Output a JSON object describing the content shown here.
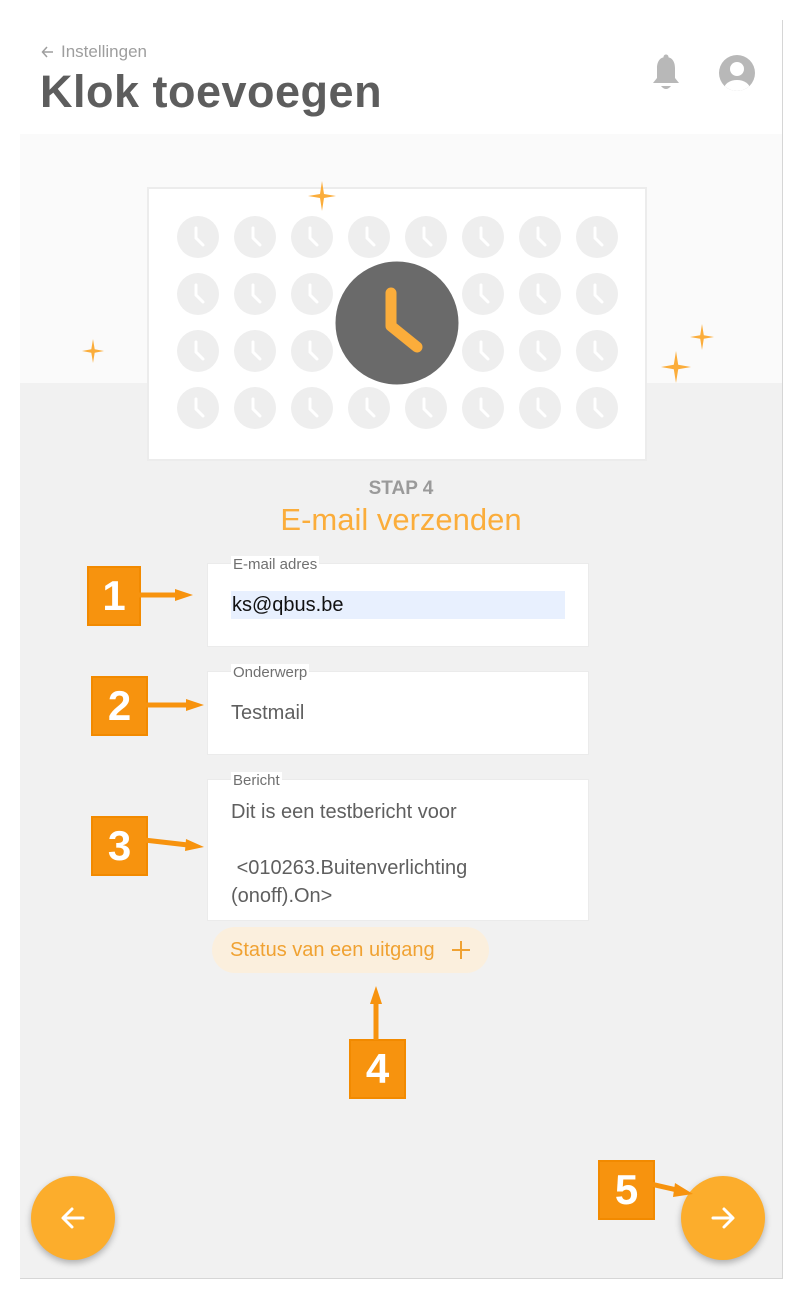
{
  "header": {
    "back_label": "Instellingen",
    "title": "Klok toevoegen",
    "icons": [
      "arrow-left-icon",
      "bell-icon",
      "user-avatar-icon"
    ]
  },
  "step": {
    "label": "STAP 4",
    "title": "E-mail verzenden"
  },
  "form": {
    "email": {
      "label": "E-mail adres",
      "value": "ks@qbus.be"
    },
    "subject": {
      "label": "Onderwerp",
      "value": "Testmail"
    },
    "message": {
      "label": "Bericht",
      "value": "Dit is een testbericht voor\n\n <010263.Buitenverlichting (onoff).On>"
    }
  },
  "add_status_button": {
    "label": "Status van een uitgang",
    "icon": "plus-icon"
  },
  "navigation": {
    "prev_icon": "arrow-left-icon",
    "next_icon": "arrow-right-icon"
  },
  "callouts": [
    "1",
    "2",
    "3",
    "4",
    "5"
  ],
  "colors": {
    "accent": "#fbad3b",
    "title_gray": "#5d5d5d",
    "callout_orange": "#f7930e",
    "clock_dark": "#6a6a6a",
    "clock_light": "#eeeeee"
  }
}
